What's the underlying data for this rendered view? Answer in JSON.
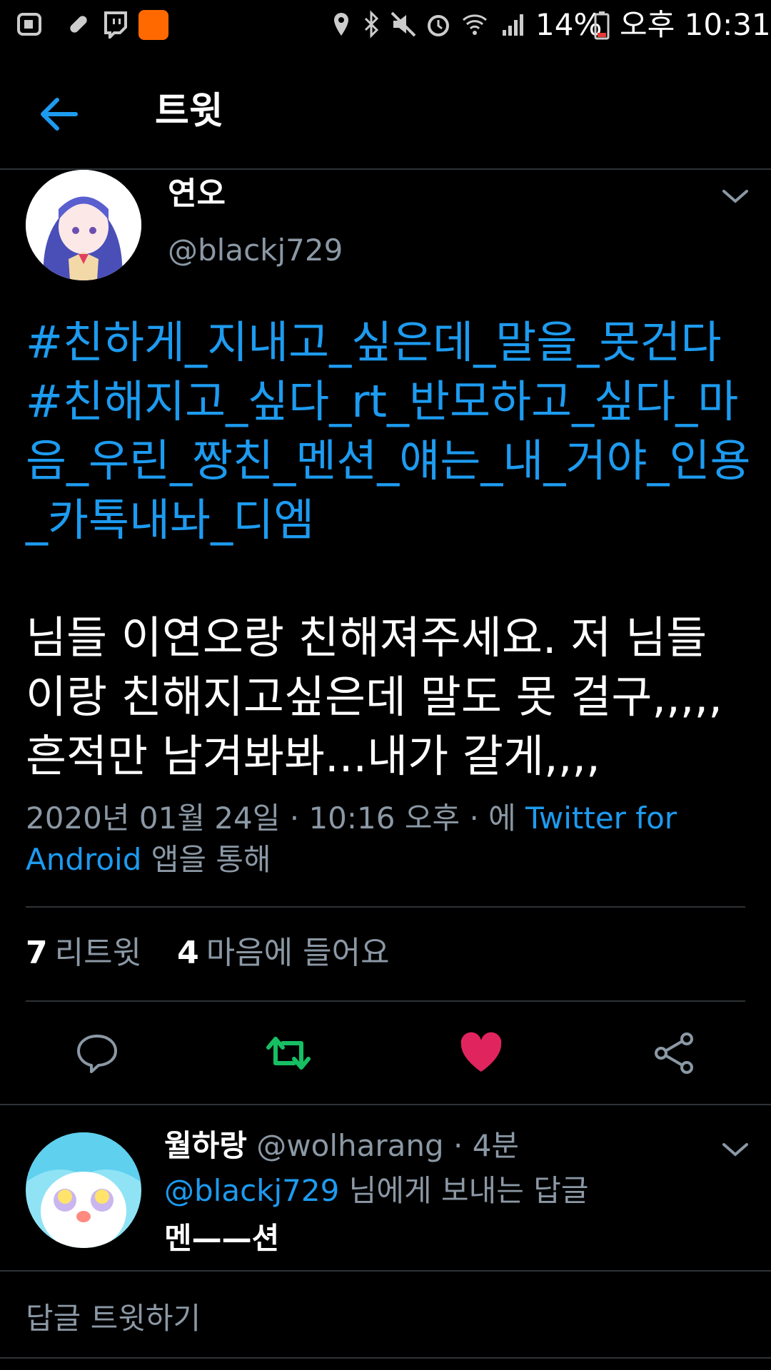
{
  "status_bar": {
    "battery": "14%",
    "time": "오후 10:31"
  },
  "app_bar": {
    "title": "트윗"
  },
  "tweet": {
    "author_name": "연오",
    "author_handle": "@blackj729",
    "hashtags": "#친하게_지내고_싶은데_말을_못건다 #친해지고_싶다_rt_반모하고_싶다_마음_우린_짱친_멘션_얘는_내_거야_인용_카톡내놔_디엠",
    "text": "님들 이연오랑 친해져주세요. 저 님들이랑 친해지고싶은데 말도 못 걸구,,,,,흔적만 남겨봐봐...내가 갈게,,,,",
    "date": "2020년 01월 24일 · 10:16 오후 · 에 ",
    "source": "Twitter for Android",
    "via_suffix": " 앱을 통해",
    "retweets_count": "7",
    "retweets_label": "리트윗",
    "likes_count": "4",
    "likes_label": "마음에 들어요"
  },
  "reply": {
    "author_name": "월하랑",
    "author_handle": "@wolharang",
    "time": " · 4분",
    "to_handle": "@blackj729",
    "to_suffix": " 님에게 보내는 답글",
    "text": "멘——션"
  },
  "compose": {
    "placeholder": "답글 트윗하기"
  },
  "colors": {
    "accent": "#1d9bf0",
    "retweet": "#17bf63",
    "like": "#e0245e",
    "muted": "#8b98a5"
  }
}
